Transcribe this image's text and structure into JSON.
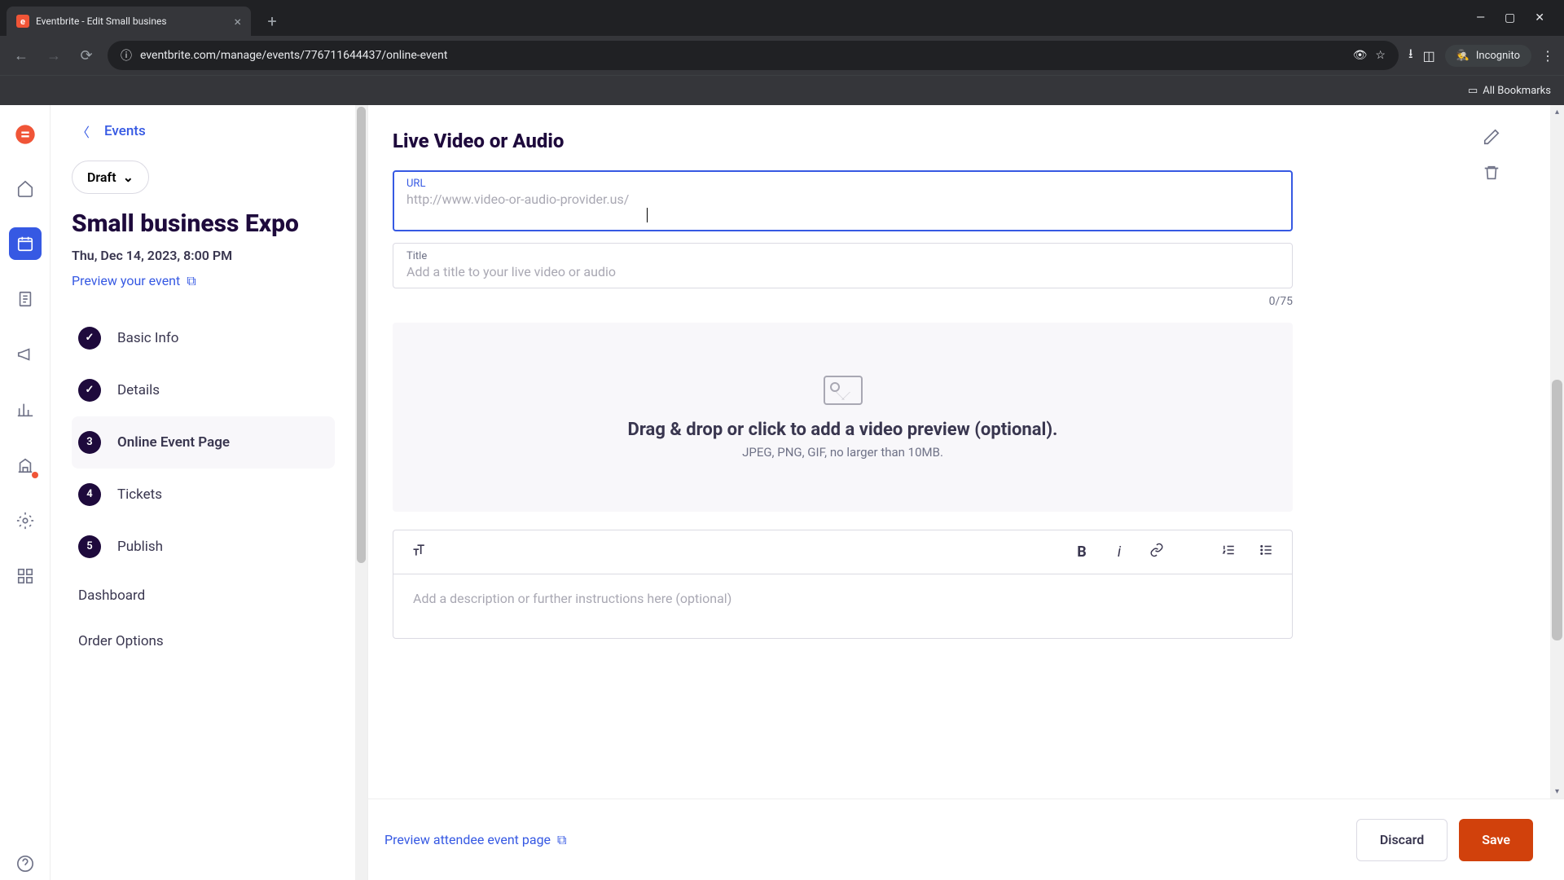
{
  "browser": {
    "tab_title": "Eventbrite - Edit Small busines",
    "url": "eventbrite.com/manage/events/776711644437/online-event",
    "incognito_label": "Incognito",
    "bookmarks_label": "All Bookmarks"
  },
  "sidebar": {
    "back_label": "Events",
    "draft_label": "Draft",
    "event_title": "Small business Expo",
    "event_date": "Thu, Dec 14, 2023, 8:00 PM",
    "preview_label": "Preview your event",
    "steps": [
      {
        "num": "✓",
        "label": "Basic Info",
        "done": true
      },
      {
        "num": "✓",
        "label": "Details",
        "done": true
      },
      {
        "num": "3",
        "label": "Online Event Page",
        "active": true
      },
      {
        "num": "4",
        "label": "Tickets"
      },
      {
        "num": "5",
        "label": "Publish"
      }
    ],
    "sections": {
      "dashboard": "Dashboard",
      "order_options": "Order Options"
    }
  },
  "main": {
    "section_title": "Live Video or Audio",
    "url_label": "URL",
    "url_placeholder": "http://www.video-or-audio-provider.us/",
    "title_label": "Title",
    "title_placeholder": "Add a title to your live video or audio",
    "char_count": "0/75",
    "dropzone_title": "Drag & drop or click to add a video preview (optional).",
    "dropzone_sub": "JPEG, PNG, GIF, no larger than 10MB.",
    "description_placeholder": "Add a description or further instructions here (optional)"
  },
  "footer": {
    "preview_label": "Preview attendee event page",
    "discard_label": "Discard",
    "save_label": "Save"
  }
}
